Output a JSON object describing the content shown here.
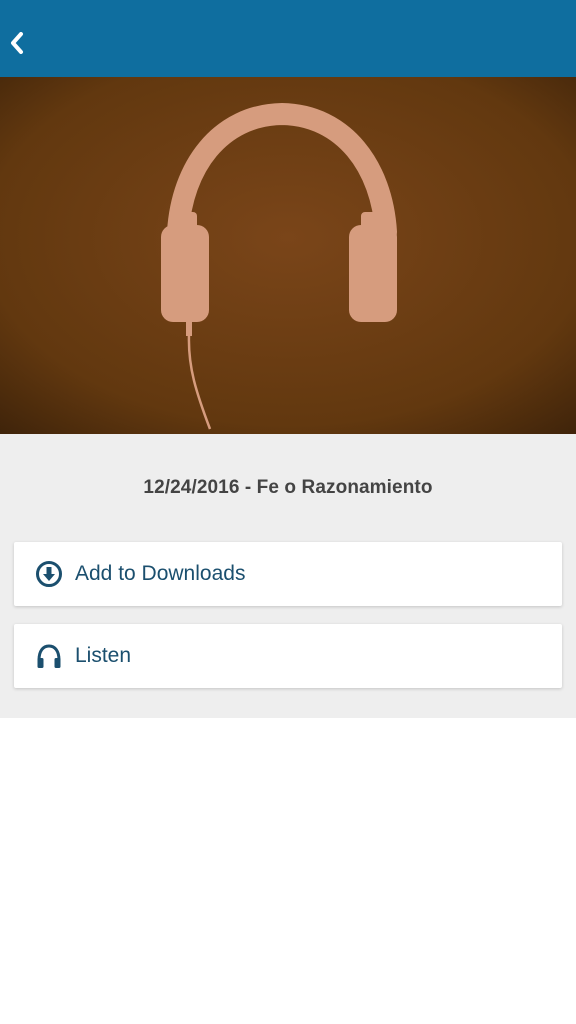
{
  "header": {
    "back_icon": "chevron-left-icon",
    "background_color": "#0f6e9f"
  },
  "hero": {
    "image": "headphones-silhouette-artwork",
    "background_color": "#6b3d17",
    "figure_color": "#d69c7e"
  },
  "episode": {
    "title": "12/24/2016 - Fe o Razonamiento"
  },
  "actions": [
    {
      "label": "Add to Downloads",
      "icon": "download-circle-icon"
    },
    {
      "label": "Listen",
      "icon": "headphones-icon"
    }
  ],
  "colors": {
    "accent": "#1b4f6e",
    "content_bg": "#eeeeee"
  }
}
